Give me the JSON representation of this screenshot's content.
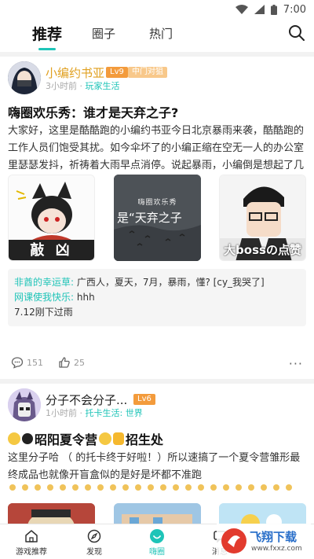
{
  "status": {
    "time": "7:00"
  },
  "top_tabs": [
    {
      "label": "推荐"
    },
    {
      "label": "圈子"
    },
    {
      "label": "热门"
    }
  ],
  "post1": {
    "author": "小编约书亚",
    "level": "Lv9",
    "role": "中门对狙",
    "time": "3小时前",
    "sep": "·",
    "tag": "玩家生活",
    "title": "嗨圈欢乐秀：谁才是天弃之子?",
    "body": "大家好，这里是酷酷跑的小编约书亚今日北京暴雨来袭，酷酷跑的工作人员们饱受其扰。如今伞坏了的小编正缩在空无一人的办公室里瑟瑟发抖，祈祷着大雨早点消停。说起暴雨，小编倒是想起了几年前...",
    "images": [
      {
        "caption": "敲 凶"
      },
      {
        "caption": "嗨圈欢乐秀",
        "sub": "是“天弃之子"
      },
      {
        "caption": "大bossの点赞"
      }
    ],
    "comments": [
      {
        "name": "非酋的幸运草:",
        "text": " 广西人，夏天，7月，暴雨，懂? [cy_我哭了]"
      },
      {
        "name": "网课使我快乐:",
        "text": " hhh"
      },
      {
        "name": "",
        "text": "7.12刚下过雨"
      }
    ],
    "comment_count": "151",
    "like_count": "25",
    "more": "···"
  },
  "post2": {
    "author": "分子不会分子...",
    "level": "Lv6",
    "time": "1小时前",
    "sep": "·",
    "tag": "托卡生活: 世界",
    "title_text1": "昭阳夏令营",
    "title_text2": "招生处",
    "body": "这里分子哈     （   的托卡终于好啦！）所以速搞了一个夏令营雏形最终成品也就像开盲盒似的是好是坏都不准跑"
  },
  "bottom_nav": [
    {
      "label": "游戏推荐"
    },
    {
      "label": "发现"
    },
    {
      "label": "嗨圈"
    },
    {
      "label": "消息"
    }
  ],
  "watermark": {
    "text": "飞翔下载",
    "url": "www.fxxz.com"
  },
  "colors": {
    "accent": "#1fc4b8",
    "author": "#e0a020",
    "lv": "#f39b3c"
  }
}
